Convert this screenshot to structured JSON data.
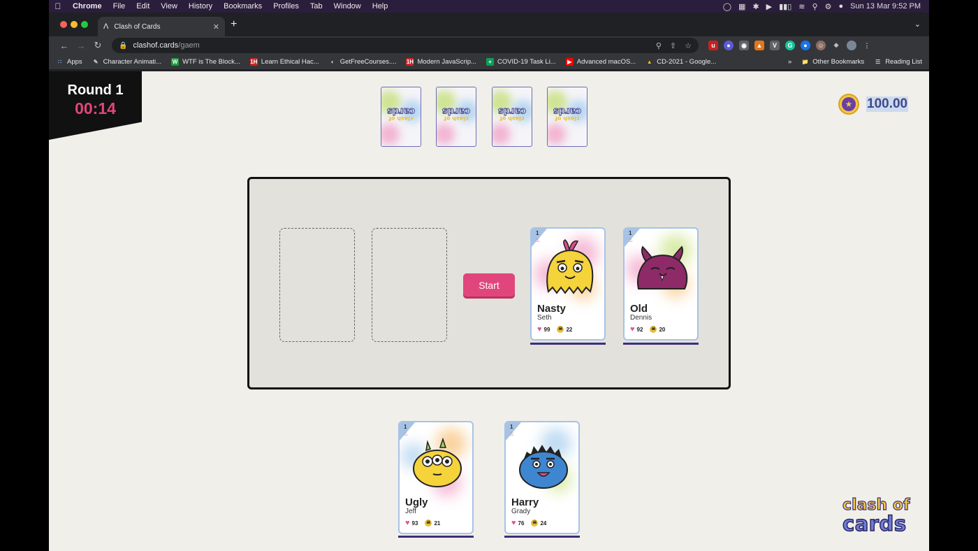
{
  "menubar": {
    "app": "Chrome",
    "items": [
      "File",
      "Edit",
      "View",
      "History",
      "Bookmarks",
      "Profiles",
      "Tab",
      "Window",
      "Help"
    ],
    "datetime": "Sun 13 Mar  9:52 PM"
  },
  "browser": {
    "tab_title": "Clash of Cards",
    "url_host": "clashof.cards",
    "url_path": "/gaem",
    "bookmarks": [
      "Apps",
      "Character Animati...",
      "WTF is The Block...",
      "Learn Ethical Hac...",
      "GetFreeCourses....",
      "Modern JavaScrip...",
      "COVID-19 Task Li...",
      "Advanced macOS...",
      "CD-2021 - Google..."
    ],
    "other_bookmarks": "Other Bookmarks",
    "reading_list": "Reading List"
  },
  "game": {
    "round_label": "Round 1",
    "timer": "00:14",
    "coins": "100.00",
    "start_label": "Start",
    "deck_text_1": "clash of",
    "deck_text_2": "cards",
    "logo_line1": "clash of",
    "logo_line2": "cards",
    "opponent_cards": [
      {
        "level": "1",
        "name": "Nasty",
        "sub": "Seth",
        "health": "99",
        "attack": "22",
        "color": "#f5d33a"
      },
      {
        "level": "1",
        "name": "Old",
        "sub": "Dennis",
        "health": "92",
        "attack": "20",
        "color": "#8e2a67"
      }
    ],
    "hand_cards": [
      {
        "level": "1",
        "name": "Ugly",
        "sub": "Jeff",
        "health": "93",
        "attack": "21",
        "color": "#f5d33a"
      },
      {
        "level": "1",
        "name": "Harry",
        "sub": "Grady",
        "health": "76",
        "attack": "24",
        "color": "#3f86d1"
      }
    ]
  },
  "colors": {
    "accent_pink": "#e0467c",
    "page_bg": "#f1efea",
    "card_border": "#a6c3e6",
    "logo_purple": "#3b2f7a"
  }
}
